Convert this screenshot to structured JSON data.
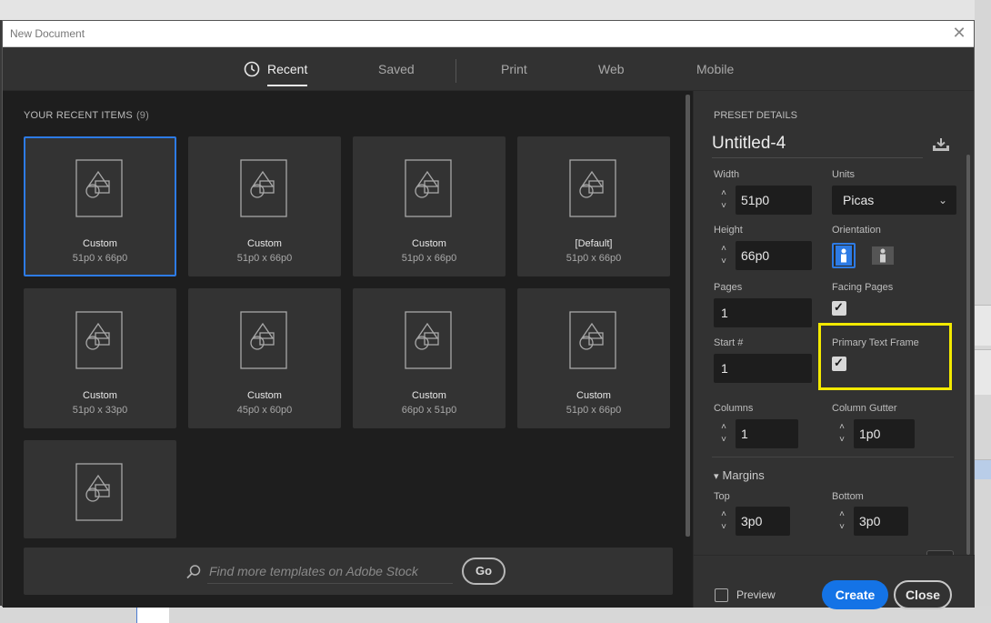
{
  "window": {
    "title": "New Document"
  },
  "tabs": [
    {
      "label": "Recent",
      "active": true
    },
    {
      "label": "Saved"
    },
    {
      "label": "Print"
    },
    {
      "label": "Web"
    },
    {
      "label": "Mobile"
    }
  ],
  "recent": {
    "heading": "YOUR RECENT ITEMS",
    "count": "(9)",
    "items": [
      {
        "name": "Custom",
        "size": "51p0 x 66p0",
        "selected": true
      },
      {
        "name": "Custom",
        "size": "51p0 x 66p0"
      },
      {
        "name": "Custom",
        "size": "51p0 x 66p0"
      },
      {
        "name": "[Default]",
        "size": "51p0 x 66p0"
      },
      {
        "name": "Custom",
        "size": "51p0 x 33p0"
      },
      {
        "name": "Custom",
        "size": "45p0 x 60p0"
      },
      {
        "name": "Custom",
        "size": "66p0 x 51p0"
      },
      {
        "name": "Custom",
        "size": "51p0 x 66p0"
      },
      {
        "name": "",
        "size": ""
      }
    ]
  },
  "search": {
    "placeholder": "Find more templates on Adobe Stock",
    "go_label": "Go"
  },
  "preset": {
    "heading": "PRESET DETAILS",
    "name": "Untitled-4",
    "width_label": "Width",
    "width": "51p0",
    "units_label": "Units",
    "units": "Picas",
    "height_label": "Height",
    "height": "66p0",
    "orientation_label": "Orientation",
    "pages_label": "Pages",
    "pages": "1",
    "facing_label": "Facing Pages",
    "facing_checked": true,
    "start_label": "Start #",
    "start": "1",
    "ptf_label": "Primary Text Frame",
    "ptf_checked": true,
    "columns_label": "Columns",
    "columns": "1",
    "gutter_label": "Column Gutter",
    "gutter": "1p0",
    "margins_label": "Margins",
    "top_label": "Top",
    "top": "3p0",
    "bottom_label": "Bottom",
    "bottom": "3p0"
  },
  "footer": {
    "preview_label": "Preview",
    "create_label": "Create",
    "close_label": "Close"
  },
  "colors": {
    "accent": "#1473e6",
    "highlight": "#f2e900"
  }
}
